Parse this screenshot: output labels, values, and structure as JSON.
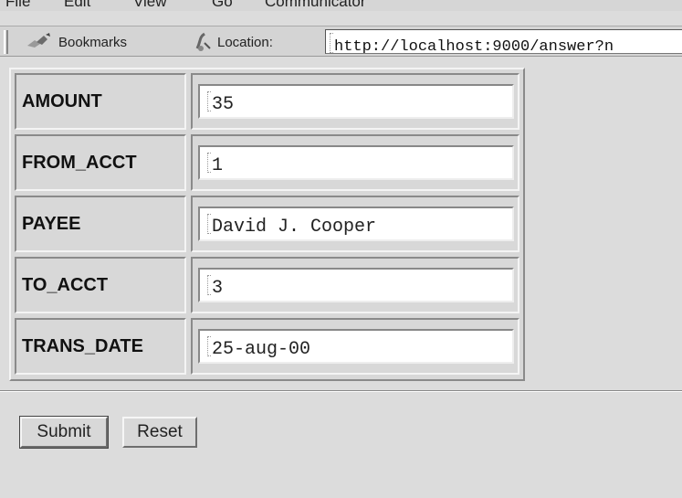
{
  "menubar": {
    "items": [
      "File",
      "Edit",
      "View",
      "Go",
      "Communicator"
    ]
  },
  "toolbar": {
    "bookmarks_label": "Bookmarks",
    "location_label": "Location:",
    "url": "http://localhost:9000/answer?n"
  },
  "form": {
    "rows": [
      {
        "label": "AMOUNT",
        "value": "35"
      },
      {
        "label": "FROM_ACCT",
        "value": "1"
      },
      {
        "label": "PAYEE",
        "value": "David J. Cooper"
      },
      {
        "label": "TO_ACCT",
        "value": "3"
      },
      {
        "label": "TRANS_DATE",
        "value": "25-aug-00"
      }
    ]
  },
  "buttons": {
    "submit_label": "Submit",
    "reset_label": "Reset"
  }
}
